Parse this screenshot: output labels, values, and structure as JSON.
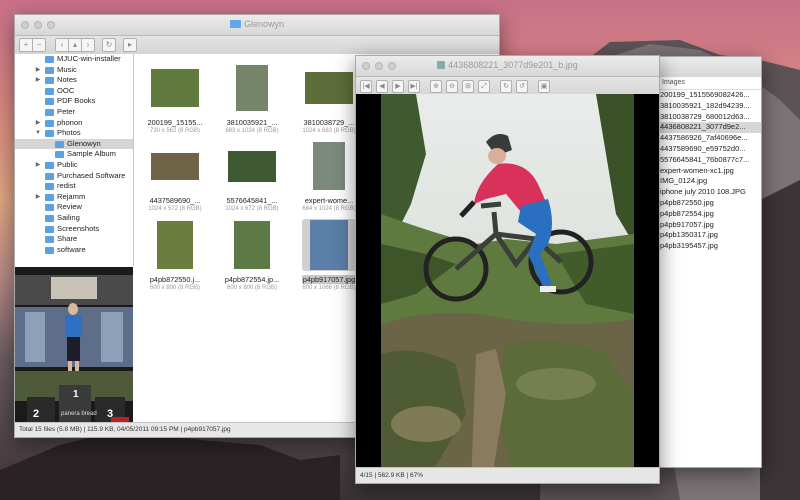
{
  "browser": {
    "title": "Glenowyn",
    "sidebar": [
      {
        "label": "MJUC-win-installer",
        "indent": 30,
        "arrow": ""
      },
      {
        "label": "Music",
        "indent": 30,
        "arrow": "▶"
      },
      {
        "label": "Notes",
        "indent": 30,
        "arrow": "▶"
      },
      {
        "label": "OOC",
        "indent": 30,
        "arrow": ""
      },
      {
        "label": "PDF Books",
        "indent": 30,
        "arrow": ""
      },
      {
        "label": "Peter",
        "indent": 30,
        "arrow": ""
      },
      {
        "label": "phonon",
        "indent": 30,
        "arrow": "▶"
      },
      {
        "label": "Photos",
        "indent": 30,
        "arrow": "▼"
      },
      {
        "label": "Glenowyn",
        "indent": 40,
        "arrow": "",
        "selected": true
      },
      {
        "label": "Sample Album",
        "indent": 40,
        "arrow": ""
      },
      {
        "label": "Public",
        "indent": 30,
        "arrow": "▶"
      },
      {
        "label": "Purchased Software",
        "indent": 30,
        "arrow": ""
      },
      {
        "label": "redist",
        "indent": 30,
        "arrow": ""
      },
      {
        "label": "Rejamm",
        "indent": 30,
        "arrow": "▶"
      },
      {
        "label": "Review",
        "indent": 30,
        "arrow": ""
      },
      {
        "label": "Sailing",
        "indent": 30,
        "arrow": ""
      },
      {
        "label": "Screenshots",
        "indent": 30,
        "arrow": ""
      },
      {
        "label": "Share",
        "indent": 30,
        "arrow": ""
      },
      {
        "label": "software",
        "indent": 30,
        "arrow": ""
      }
    ],
    "thumbs": [
      {
        "name": "200199_15155...",
        "info": "730 x 562 (8 RGB)",
        "w": 48,
        "h": 38,
        "c": "#5f7a3c"
      },
      {
        "name": "3810035921_...",
        "info": "683 x 1024 (8 RGB)",
        "w": 32,
        "h": 46,
        "c": "#76856a"
      },
      {
        "name": "3810038729_...",
        "info": "1024 x 683 (8 RGB)",
        "w": 48,
        "h": 32,
        "c": "#5e6e3a"
      },
      {
        "name": "4437589690_...",
        "info": "1024 x 572 (8 RGB)",
        "w": 48,
        "h": 27,
        "c": "#6f6448"
      },
      {
        "name": "5576645841_...",
        "info": "1024 x 672 (8 RGB)",
        "w": 48,
        "h": 31,
        "c": "#3f5a32"
      },
      {
        "name": "expert-wome...",
        "info": "684 x 1024 (8 RGB)",
        "w": 32,
        "h": 48,
        "c": "#7b8a7c"
      },
      {
        "name": "p4pb872550.j...",
        "info": "600 x 800 (8 RGB)",
        "w": 36,
        "h": 48,
        "c": "#6b7d3f"
      },
      {
        "name": "p4pb872554.jp...",
        "info": "600 x 800 (8 RGB)",
        "w": 36,
        "h": 48,
        "c": "#5d7a46"
      },
      {
        "name": "p4pb917057.jpg",
        "info": "600 x 1066 (8 RGB)",
        "w": 38,
        "h": 50,
        "c": "#5a7fa8",
        "selected": true
      }
    ],
    "status": "Total 15 files (5.8 MB)  |  115.9 KB, 04/05/2011 09:15 PM  |  p4pb917057.jpg",
    "preview_caption": "panera bread"
  },
  "viewer": {
    "title": "4436808221_3077d9e201_b.jpg",
    "tools": [
      "|◀",
      "◀",
      "▶",
      "▶|",
      "⊕",
      "⊖",
      "⊞",
      "⤢",
      "↻",
      "↺",
      "▣"
    ],
    "status": "4/15  |  562.9 KB  |  67%"
  },
  "images": {
    "header": "Images",
    "items": [
      "200199_1515569082426...",
      "3810035921_182d94239...",
      "3810038729_680012d63...",
      "4436808221_3077d9e2...",
      "4437586926_7af40696e...",
      "4437589690_e59752d0...",
      "5576645841_76b0877c7...",
      "expert-women-xc1.jpg",
      "IMG_0124.jpg",
      "iphone july 2010 108.JPG",
      "p4pb872550.jpg",
      "p4pb872554.jpg",
      "p4pb917057.jpg",
      "p4pb1350317.jpg",
      "p4pb3195457.jpg"
    ],
    "selected_index": 3
  }
}
